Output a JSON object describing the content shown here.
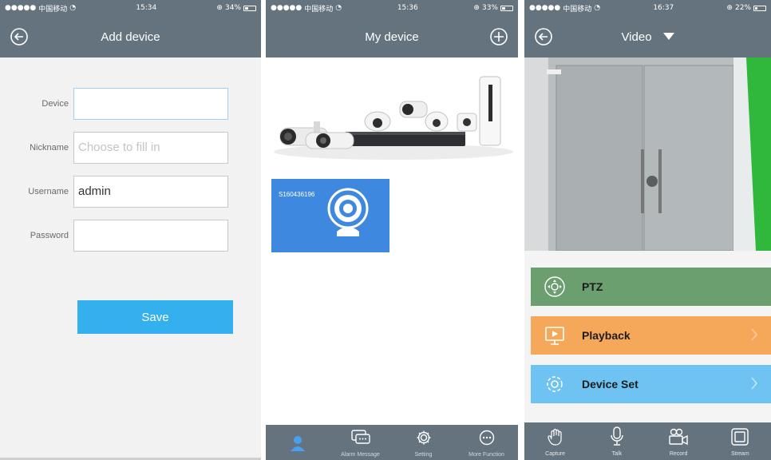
{
  "add_device_screen": {
    "status": {
      "carrier": "中国移动",
      "time": "15:34",
      "battery": "34%",
      "battery_level": 0.34
    },
    "title": "Add device",
    "fields": [
      {
        "label": "Device",
        "value": "",
        "placeholder": ""
      },
      {
        "label": "Nickname",
        "value": "",
        "placeholder": "Choose to fill in"
      },
      {
        "label": "Username",
        "value": "admin",
        "placeholder": ""
      },
      {
        "label": "Password",
        "value": "",
        "placeholder": ""
      }
    ],
    "save_label": "Save"
  },
  "my_device_screen": {
    "status": {
      "carrier": "中国移动",
      "time": "15:36",
      "battery": "33%",
      "battery_level": 0.33
    },
    "title": "My device",
    "device_id": "S160436196",
    "tabs": [
      {
        "label": "",
        "icon": "person-icon",
        "active": true
      },
      {
        "label": "Alarm Message",
        "icon": "message-icon",
        "active": false
      },
      {
        "label": "Setting",
        "icon": "gear-icon",
        "active": false
      },
      {
        "label": "More Function",
        "icon": "more-icon",
        "active": false
      }
    ]
  },
  "video_screen": {
    "status": {
      "carrier": "中国移动",
      "time": "16:37",
      "battery": "22%",
      "battery_level": 0.22
    },
    "title": "Video",
    "menu": [
      {
        "label": "PTZ",
        "icon": "ptz-icon",
        "color": "#6b9f70",
        "chevron": false
      },
      {
        "label": "Playback",
        "icon": "playback-icon",
        "color": "#f5a85a",
        "chevron": true
      },
      {
        "label": "Device Set",
        "icon": "settings-icon",
        "color": "#6ec3f2",
        "chevron": true
      }
    ],
    "tools": [
      {
        "label": "Capture",
        "icon": "hand-icon"
      },
      {
        "label": "Talk",
        "icon": "microphone-icon"
      },
      {
        "label": "Record",
        "icon": "video-camera-icon"
      },
      {
        "label": "Stream",
        "icon": "stream-icon"
      }
    ]
  },
  "colors": {
    "header": "#65737e",
    "accent_blue": "#34b0ef",
    "device_card": "#3f88e0"
  }
}
